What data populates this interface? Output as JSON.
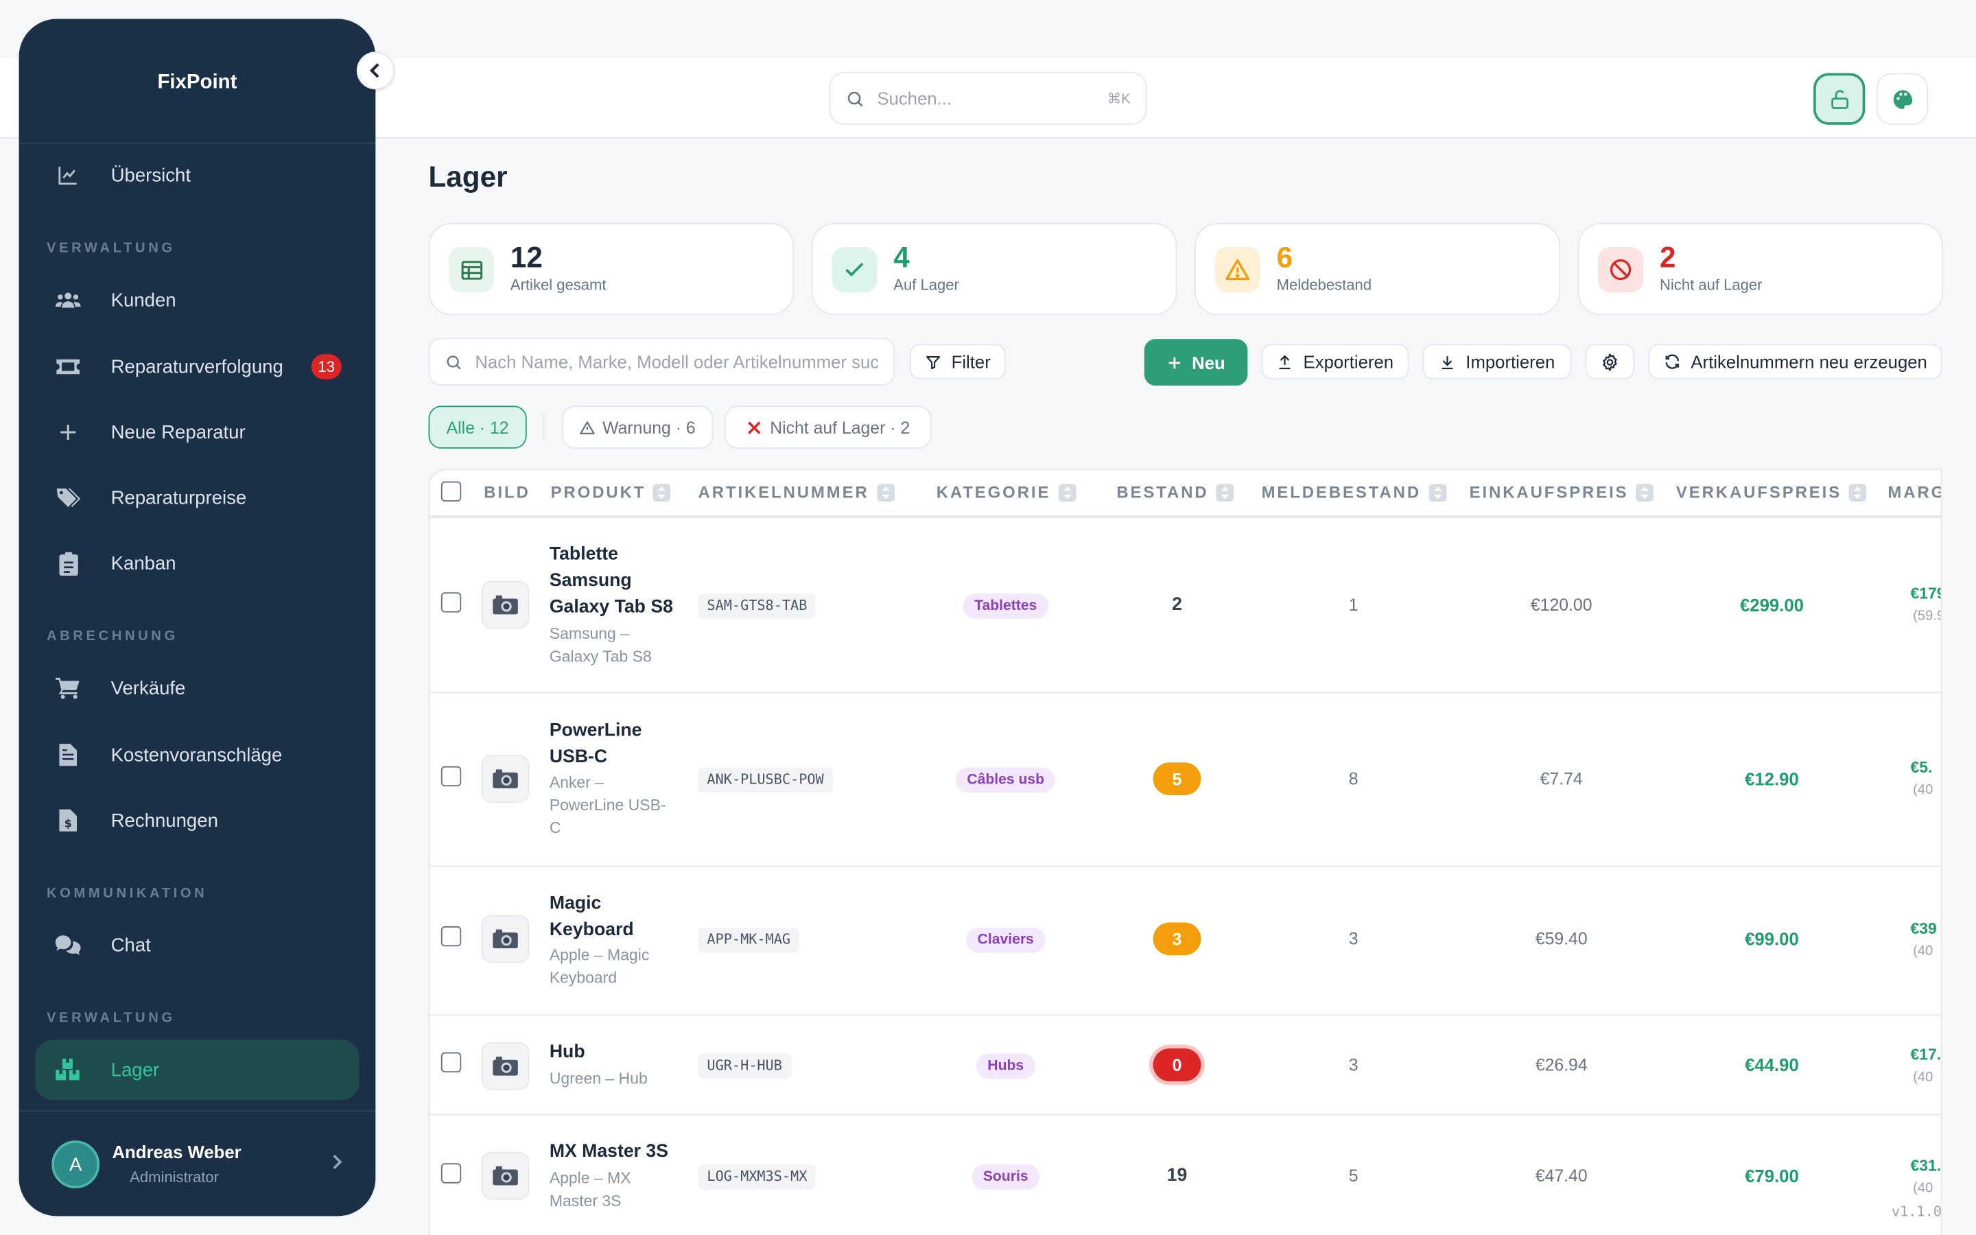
{
  "app": {
    "name": "FixPoint",
    "version": "v1.1.0"
  },
  "header": {
    "search_placeholder": "Suchen...",
    "search_shortcut": "⌘K"
  },
  "sidebar": {
    "overview": "Übersicht",
    "sections": {
      "verwaltung": "VERWALTUNG",
      "abrechnung": "ABRECHNUNG",
      "kommunikation": "KOMMUNIKATION",
      "verwaltung2": "VERWALTUNG"
    },
    "items": {
      "kunden": "Kunden",
      "reparaturverfolgung": "Reparaturverfolgung",
      "reparaturverfolgung_badge": "13",
      "neue_reparatur": "Neue Reparatur",
      "reparaturpreise": "Reparaturpreise",
      "kanban": "Kanban",
      "verkaeufe": "Verkäufe",
      "kostenvoranschlaege": "Kostenvoranschläge",
      "rechnungen": "Rechnungen",
      "chat": "Chat",
      "lager": "Lager"
    },
    "user": {
      "initial": "A",
      "name": "Andreas Weber",
      "role": "Administrator"
    }
  },
  "page": {
    "title": "Lager"
  },
  "stats": [
    {
      "value": "12",
      "label": "Artikel gesamt",
      "color": "#1e293b"
    },
    {
      "value": "4",
      "label": "Auf Lager",
      "color": "#1f9d6b"
    },
    {
      "value": "6",
      "label": "Meldebestand",
      "color": "#f59e0b"
    },
    {
      "value": "2",
      "label": "Nicht auf Lager",
      "color": "#dc2626"
    }
  ],
  "toolbar": {
    "search_placeholder": "Nach Name, Marke, Modell oder Artikelnummer suchen",
    "filter": "Filter",
    "new": "Neu",
    "export": "Exportieren",
    "import": "Importieren",
    "regenerate": "Artikelnummern neu erzeugen"
  },
  "filters": {
    "all": "Alle · 12",
    "warning": "Warnung · 6",
    "out_of_stock": "Nicht auf Lager · 2"
  },
  "table": {
    "columns": {
      "bild": "BILD",
      "produkt": "PRODUKT",
      "artikelnummer": "ARTIKELNUMMER",
      "kategorie": "KATEGORIE",
      "bestand": "BESTAND",
      "meldebestand": "MELDEBESTAND",
      "einkaufspreis": "EINKAUFSPREIS",
      "verkaufspreis": "VERKAUFSPREIS",
      "marge": "MARG"
    },
    "rows": [
      {
        "name": "Tablette Samsung Galaxy Tab S8",
        "sub": "Samsung – Galaxy Tab S8",
        "sku": "SAM-GTS8-TAB",
        "category": "Tablettes",
        "stock": "2",
        "stock_state": "ok",
        "min_stock": "1",
        "buy": "€120.00",
        "sell": "€299.00",
        "margin": "€179",
        "margin_pct": "(59.9"
      },
      {
        "name": "PowerLine USB-C",
        "sub": "Anker – PowerLine USB-C",
        "sku": "ANK-PLUSBC-POW",
        "category": "Câbles usb",
        "stock": "5",
        "stock_state": "warning",
        "min_stock": "8",
        "buy": "€7.74",
        "sell": "€12.90",
        "margin": "€5.",
        "margin_pct": "(40"
      },
      {
        "name": "Magic Keyboard",
        "sub": "Apple – Magic Keyboard",
        "sku": "APP-MK-MAG",
        "category": "Claviers",
        "stock": "3",
        "stock_state": "warning",
        "min_stock": "3",
        "buy": "€59.40",
        "sell": "€99.00",
        "margin": "€39",
        "margin_pct": "(40"
      },
      {
        "name": "Hub",
        "sub": "Ugreen – Hub",
        "sku": "UGR-H-HUB",
        "category": "Hubs",
        "stock": "0",
        "stock_state": "out",
        "min_stock": "3",
        "buy": "€26.94",
        "sell": "€44.90",
        "margin": "€17.",
        "margin_pct": "(40"
      },
      {
        "name": "MX Master 3S",
        "sub": "Apple – MX Master 3S",
        "sku": "LOG-MXM3S-MX",
        "category": "Souris",
        "stock": "19",
        "stock_state": "ok",
        "min_stock": "5",
        "buy": "€47.40",
        "sell": "€79.00",
        "margin": "€31.",
        "margin_pct": "(40"
      }
    ]
  }
}
